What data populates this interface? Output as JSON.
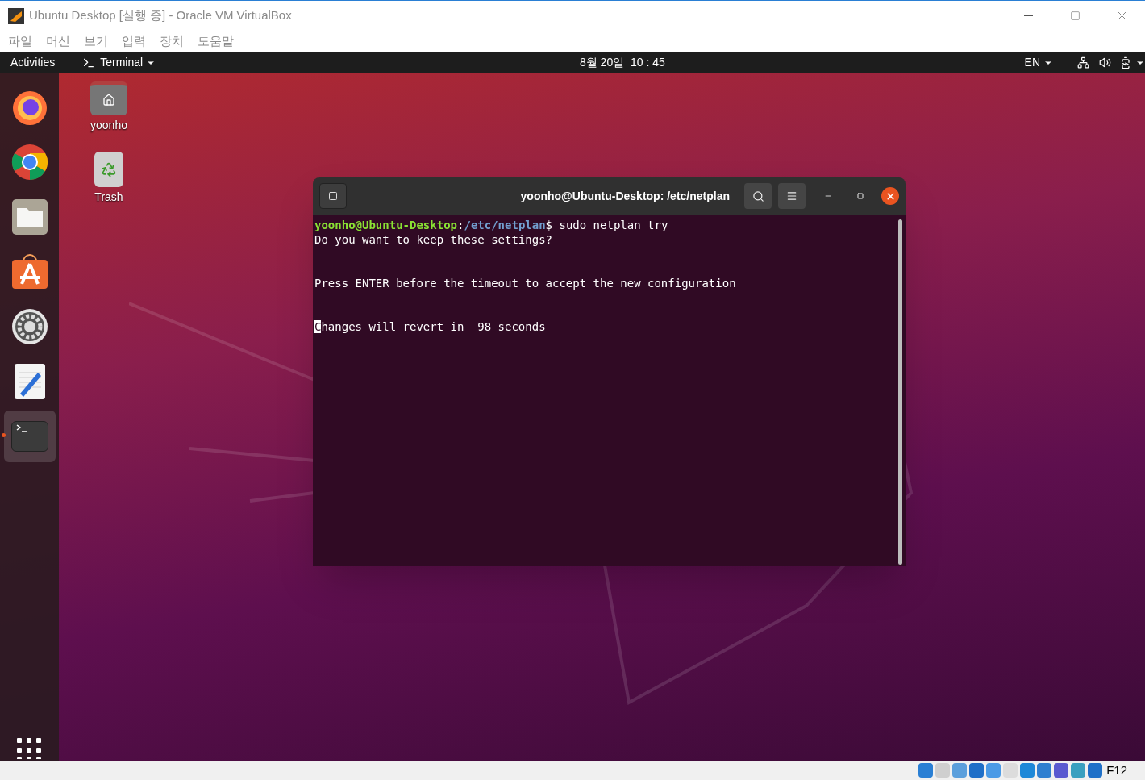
{
  "window": {
    "title": "Ubuntu Desktop [실행 중] - Oracle VM VirtualBox"
  },
  "menu": [
    "파일",
    "머신",
    "보기",
    "입력",
    "장치",
    "도움말"
  ],
  "top_bar": {
    "activities": "Activities",
    "app": "Terminal",
    "clock": "8월 20일  10 : 45",
    "language": "EN"
  },
  "dock": [
    {
      "kind": "firefox",
      "running": false
    },
    {
      "kind": "chrome",
      "running": false
    },
    {
      "kind": "files",
      "running": false
    },
    {
      "kind": "software",
      "running": false
    },
    {
      "kind": "settings",
      "running": false
    },
    {
      "kind": "editor",
      "running": false
    },
    {
      "kind": "terminal",
      "running": true
    }
  ],
  "desktop_icons": [
    {
      "kind": "home",
      "label": "yoonho"
    },
    {
      "kind": "trash",
      "label": "Trash"
    }
  ],
  "terminal": {
    "title": "yoonho@Ubuntu-Desktop: /etc/netplan",
    "lines": [
      {
        "kind": "prompt",
        "user_host": "yoonho@Ubuntu-Desktop",
        "separator": ":",
        "path": "/etc/netplan",
        "prompt_char": "$",
        "command": " sudo netplan try",
        "gap_before": false,
        "cursor": false
      },
      {
        "kind": "output",
        "text": "Do you want to keep these settings?",
        "gap_before": false,
        "cursor": false
      },
      {
        "kind": "output",
        "text": "Press ENTER before the timeout to accept the new configuration",
        "gap_before": true,
        "cursor": false
      },
      {
        "kind": "output",
        "text": "Changes will revert in  98 seconds",
        "gap_before": true,
        "cursor": true
      }
    ]
  },
  "status_bar": {
    "host_key": "F12"
  }
}
